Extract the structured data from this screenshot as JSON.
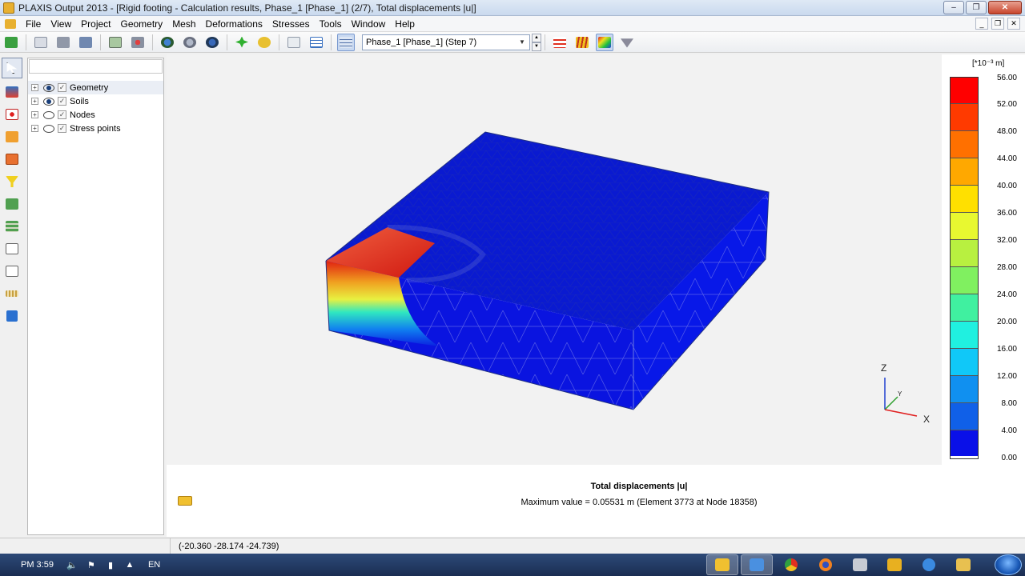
{
  "window": {
    "title": "PLAXIS Output 2013 - [Rigid footing - Calculation results, Phase_1 [Phase_1] (2/7), Total displacements |u|]",
    "minimize": "‒",
    "restore": "❐",
    "close": "✕"
  },
  "menu": {
    "items": [
      "File",
      "View",
      "Project",
      "Geometry",
      "Mesh",
      "Deformations",
      "Stresses",
      "Tools",
      "Window",
      "Help"
    ],
    "mdi_minimize": "_",
    "mdi_restore": "❐",
    "mdi_close": "✕"
  },
  "toolbar": {
    "phase_selector_value": "Phase_1 [Phase_1] (Step 7)",
    "dropdown_arrow": "▼",
    "spin_up": "▲",
    "spin_down": "▼"
  },
  "model_explorer": {
    "search_placeholder": "",
    "items": [
      {
        "label": "Geometry",
        "expander": "+",
        "visible": true,
        "checked": "✓"
      },
      {
        "label": "Soils",
        "expander": "+",
        "visible": true,
        "checked": "✓"
      },
      {
        "label": "Nodes",
        "expander": "+",
        "visible": false,
        "checked": "✓"
      },
      {
        "label": "Stress points",
        "expander": "+",
        "visible": false,
        "checked": "✓"
      }
    ]
  },
  "legend": {
    "unit": "[*10⁻³ m]",
    "ticks": [
      "56.00",
      "52.00",
      "48.00",
      "44.00",
      "40.00",
      "36.00",
      "32.00",
      "28.00",
      "24.00",
      "20.00",
      "16.00",
      "12.00",
      "8.00",
      "4.00",
      "0.00"
    ],
    "colors": [
      "#ff0000",
      "#ff3a00",
      "#ff7000",
      "#ffa800",
      "#ffe000",
      "#e8f830",
      "#b8f040",
      "#80f060",
      "#40f0a0",
      "#20f0e0",
      "#10c8f8",
      "#1090f0",
      "#1060e8",
      "#0a30e0",
      "#0000e0"
    ]
  },
  "axes": {
    "z_label": "Z",
    "y_label": "Y",
    "x_label": "X"
  },
  "caption": {
    "title": "Total displacements |u|",
    "value": "Maximum value = 0.05531 m (Element 3773 at Node 18358)"
  },
  "status": {
    "coordinates": "(-20.360 -28.174 -24.739)"
  },
  "taskbar": {
    "clock": "PM 3:59",
    "language": "EN",
    "tray_up_arrow": "▲"
  }
}
